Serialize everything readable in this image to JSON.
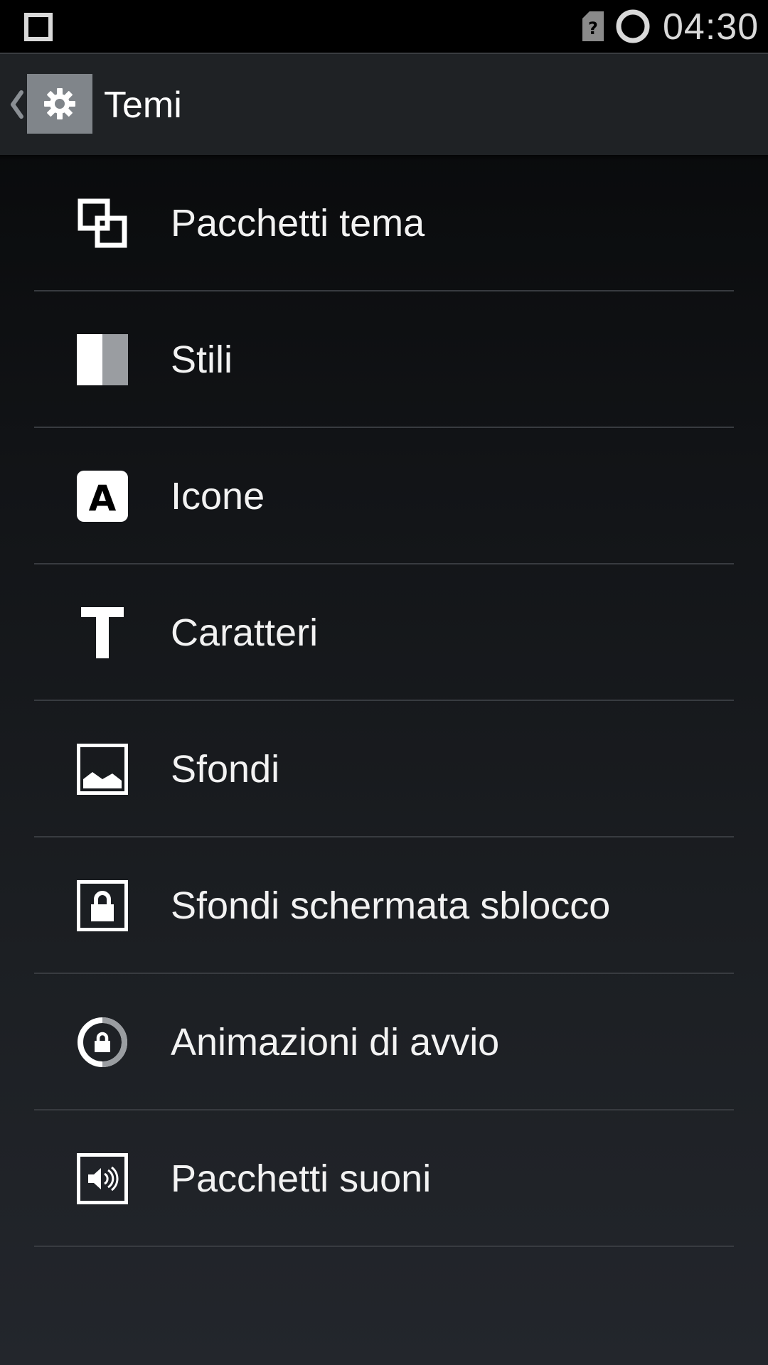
{
  "status_bar": {
    "time": "04:30",
    "icons": [
      "recents-square-icon",
      "sim-unknown-icon",
      "loading-ring-icon"
    ]
  },
  "action_bar": {
    "title": "Temi",
    "icons": [
      "back-chevron-icon",
      "settings-gear-icon"
    ]
  },
  "menu": {
    "items": [
      {
        "label": "Pacchetti tema",
        "icon": "theme-packs-icon"
      },
      {
        "label": "Stili",
        "icon": "styles-icon"
      },
      {
        "label": "Icone",
        "icon": "icons-letter-a-icon"
      },
      {
        "label": "Caratteri",
        "icon": "fonts-t-icon"
      },
      {
        "label": "Sfondi",
        "icon": "wallpaper-icon"
      },
      {
        "label": "Sfondi schermata sblocco",
        "icon": "lockscreen-wallpaper-icon"
      },
      {
        "label": "Animazioni di avvio",
        "icon": "boot-animation-icon"
      },
      {
        "label": "Pacchetti suoni",
        "icon": "sound-packs-icon"
      }
    ]
  },
  "colors": {
    "status_bar_bg": "#000000",
    "action_bar_bg": "#1f2225",
    "icon_box_bg": "#80858a",
    "divider": "#383b40",
    "text": "#f2f2f2"
  }
}
